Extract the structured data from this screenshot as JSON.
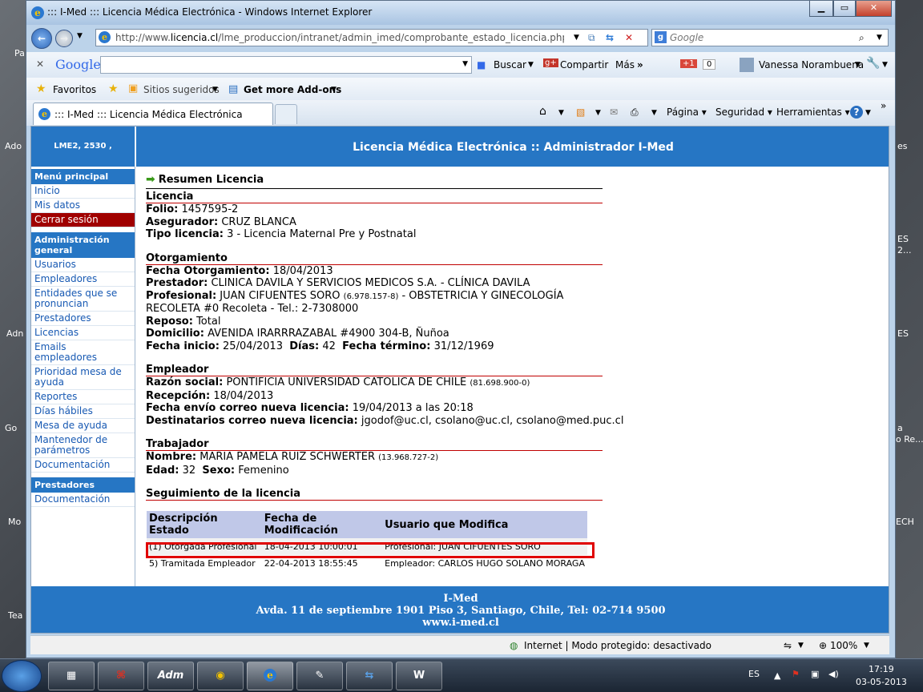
{
  "window": {
    "title": "::: I-Med ::: Licencia Médica Electrónica - Windows Internet Explorer"
  },
  "address": {
    "url_prefix": "http://www.",
    "url_domain": "licencia.cl",
    "url_rest": "/lme_produccion/intranet/admin_imed/comprobante_estado_licencia.php?id_licenci",
    "search_placeholder": "Google"
  },
  "google_toolbar": {
    "logo": "Google",
    "buscar": "Buscar",
    "compartir": "Compartir",
    "mas": "Más",
    "plus": "+1",
    "count": "0",
    "user": "Vanessa Norambuena"
  },
  "favorites": {
    "favoritos": "Favoritos",
    "sugeridos": "Sitios sugeridos",
    "addons": "Get more Add-ons"
  },
  "tab": {
    "title": "::: I-Med ::: Licencia Médica Electrónica"
  },
  "commands": {
    "pagina": "Página",
    "seguridad": "Seguridad",
    "herramientas": "Herramientas"
  },
  "page": {
    "header_left": "LME2, 2530 ,",
    "header_title": "Licencia Médica Electrónica :: Administrador I-Med",
    "menu": {
      "principal": "Menú principal",
      "items1": [
        "Inicio",
        "Mis datos",
        "Cerrar sesión"
      ],
      "admin": "Administración general",
      "items2": [
        "Usuarios",
        "Empleadores",
        "Entidades que se pronuncian",
        "Prestadores",
        "Licencias",
        "Emails empleadores",
        "Prioridad mesa de ayuda",
        "Reportes",
        "Días hábiles",
        "Mesa de ayuda",
        "Mantenedor de parámetros",
        "Documentación"
      ],
      "prestadores": "Prestadores",
      "items3": [
        "Documentación"
      ]
    },
    "resumen": "Resumen Licencia",
    "licencia": {
      "title": "Licencia",
      "folio_l": "Folio:",
      "folio": "1457595-2",
      "aseg_l": "Asegurador:",
      "aseg": "CRUZ BLANCA",
      "tipo_l": "Tipo licencia:",
      "tipo": "3 - Licencia Maternal Pre y Postnatal"
    },
    "otorg": {
      "title": "Otorgamiento",
      "fecha_l": "Fecha Otorgamiento:",
      "fecha": "18/04/2013",
      "prest_l": "Prestador:",
      "prest": "CLINICA DAVILA Y SERVICIOS MEDICOS S.A. - CLÍNICA DAVILA",
      "prof_l": "Profesional:",
      "prof_a": "JUAN CIFUENTES SORO",
      "prof_rut": "(6.978.157-8)",
      "prof_b": "- OBSTETRICIA Y GINECOLOGÍA",
      "prof_c": "RECOLETA #0 Recoleta - Tel.: 2-7308000",
      "rep_l": "Reposo:",
      "rep": "Total",
      "dom_l": "Domicilio:",
      "dom": "AVENIDA IRARRRAZABAL #4900 304-B, Ñuñoa",
      "ini_l": "Fecha inicio:",
      "ini": "25/04/2013",
      "dias_l": "Días:",
      "dias": "42",
      "fin_l": "Fecha término:",
      "fin": "31/12/1969"
    },
    "empl": {
      "title": "Empleador",
      "rs_l": "Razón social:",
      "rs": "PONTIFICIA UNIVERSIDAD CATOLICA DE CHILE",
      "rs_rut": "(81.698.900-0)",
      "rec_l": "Recepción:",
      "rec": "18/04/2013",
      "env_l": "Fecha envío correo nueva licencia:",
      "env": "19/04/2013 a las 20:18",
      "dest_l": "Destinatarios correo nueva licencia:",
      "dest": "jgodof@uc.cl, csolano@uc.cl, csolano@med.puc.cl"
    },
    "trab": {
      "title": "Trabajador",
      "nom_l": "Nombre:",
      "nom": "MARIA PAMELA RUIZ SCHWERTER",
      "nom_rut": "(13.968.727-2)",
      "edad_l": "Edad:",
      "edad": "32",
      "sexo_l": "Sexo:",
      "sexo": "Femenino"
    },
    "seg": {
      "title": "Seguimiento de la licencia",
      "headers": [
        "Descripción Estado",
        "Fecha de Modificación",
        "Usuario que Modifica"
      ],
      "rows": [
        [
          "(1) Otorgada Profesional",
          "18-04-2013 10:00:01",
          "Profesional: JUAN CIFUENTES SORO"
        ],
        [
          "5) Tramitada Empleador",
          "22-04-2013 18:55:45",
          "Empleador: CARLOS HUGO SOLANO MORAGA"
        ]
      ]
    },
    "footer": {
      "l1": "I-Med",
      "l2": "Avda. 11 de septiembre 1901 Piso 3, Santiago, Chile, Tel: 02-714 9500",
      "l3": "www.i-med.cl"
    }
  },
  "status": {
    "zone": "Internet | Modo protegido: desactivado",
    "zoom": "100%"
  },
  "taskbar": {
    "lang": "ES",
    "time": "17:19",
    "date": "03-05-2013",
    "adm": "Adm"
  },
  "desktop": {
    "labels": [
      "Pa",
      "Ado",
      "Adn",
      "Go",
      "Mo",
      "Tea",
      "es",
      "ES",
      "2...",
      "ES",
      "a",
      "o Re...",
      "ECH"
    ]
  }
}
